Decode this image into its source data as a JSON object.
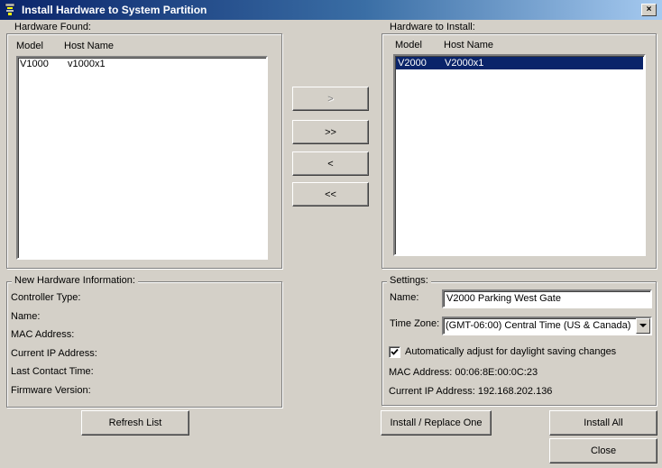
{
  "window": {
    "title": "Install Hardware to System Partition",
    "close_glyph": "×"
  },
  "found": {
    "legend": "Hardware Found:",
    "col_model": "Model",
    "col_host": "Host Name",
    "rows": [
      {
        "model": "V1000",
        "host": "v1000x1"
      }
    ]
  },
  "install": {
    "legend": "Hardware to Install:",
    "col_model": "Model",
    "col_host": "Host Name",
    "rows": [
      {
        "model": "V2000",
        "host": "V2000x1",
        "selected": true
      }
    ]
  },
  "move_buttons": {
    "add_one": ">",
    "add_all": ">>",
    "remove_one": "<",
    "remove_all": "<<"
  },
  "new_info": {
    "legend": "New Hardware Information:",
    "controller_type": "Controller Type:",
    "name": "Name:",
    "mac": "MAC Address:",
    "current_ip": "Current IP Address:",
    "last_contact": "Last Contact Time:",
    "firmware": "Firmware Version:"
  },
  "settings": {
    "legend": "Settings:",
    "name_label": "Name:",
    "name_value": "V2000 Parking West Gate",
    "tz_label": "Time Zone:",
    "tz_value": "(GMT-06:00) Central Time (US & Canada)",
    "dst_label": "Automatically adjust for daylight saving changes",
    "dst_checked": true,
    "mac_line": "MAC Address: 00:06:8E:00:0C:23",
    "ip_line": "Current IP Address: 192.168.202.136"
  },
  "buttons": {
    "refresh": "Refresh List",
    "install_replace": "Install / Replace One",
    "install_all": "Install All",
    "close": "Close"
  },
  "colors": {
    "face": "#d4d0c8",
    "selection": "#0a246a",
    "title_start": "#0a246a",
    "title_end": "#a6caf0"
  },
  "icons": {
    "app": "hardware-icon",
    "check": "check-icon",
    "dropdown": "chevron-down-icon"
  }
}
